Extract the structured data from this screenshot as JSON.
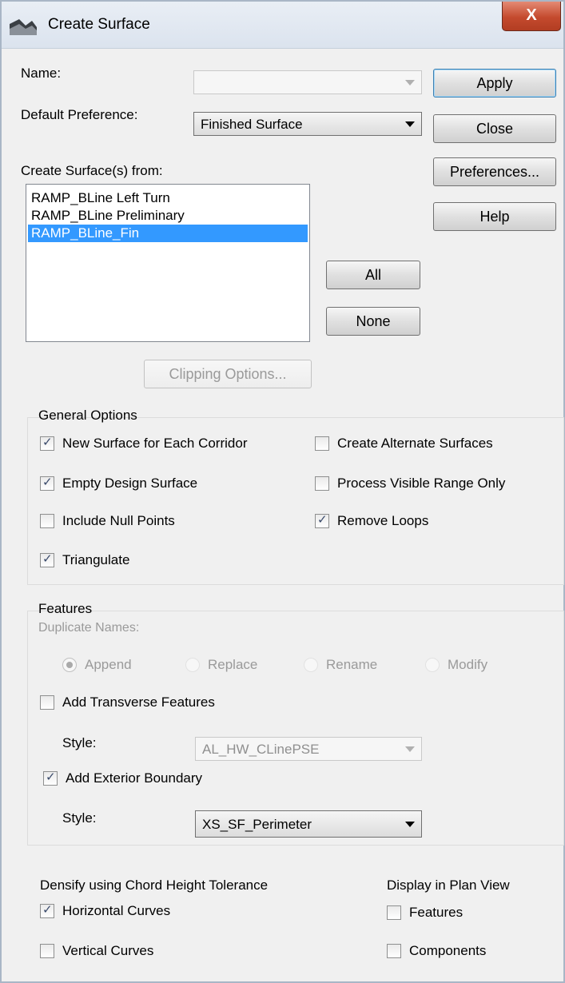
{
  "window": {
    "title": "Create Surface",
    "close_glyph": "X"
  },
  "form": {
    "name_label": "Name:",
    "name_value": "",
    "default_preference_label": "Default Preference:",
    "default_preference_value": "Finished Surface",
    "create_from_label": "Create Surface(s) from:",
    "surfaces": [
      {
        "label": "RAMP_BLine Left Turn",
        "selected": false
      },
      {
        "label": "RAMP_BLine Preliminary",
        "selected": false
      },
      {
        "label": "RAMP_BLine_Fin",
        "selected": true
      }
    ]
  },
  "buttons": {
    "apply": "Apply",
    "close": "Close",
    "preferences": "Preferences...",
    "help": "Help",
    "all": "All",
    "none": "None",
    "clipping": "Clipping Options..."
  },
  "general_options": {
    "title": "General Options",
    "new_surface_each_corridor": {
      "label": "New Surface for Each Corridor",
      "checked": true
    },
    "create_alternate_surfaces": {
      "label": "Create Alternate Surfaces",
      "checked": false
    },
    "empty_design_surface": {
      "label": "Empty Design Surface",
      "checked": true
    },
    "process_visible_range_only": {
      "label": "Process Visible Range Only",
      "checked": false
    },
    "include_null_points": {
      "label": "Include Null Points",
      "checked": false
    },
    "remove_loops": {
      "label": "Remove Loops",
      "checked": true
    },
    "triangulate": {
      "label": "Triangulate",
      "checked": true
    }
  },
  "features": {
    "title": "Features",
    "duplicate_names_label": "Duplicate Names:",
    "duplicate_options": [
      {
        "label": "Append",
        "selected": true
      },
      {
        "label": "Replace",
        "selected": false
      },
      {
        "label": "Rename",
        "selected": false
      },
      {
        "label": "Modify",
        "selected": false
      }
    ],
    "add_transverse": {
      "label": "Add Transverse Features",
      "checked": false
    },
    "transverse_style_label": "Style:",
    "transverse_style_value": "AL_HW_CLinePSE",
    "add_exterior_boundary": {
      "label": "Add Exterior Boundary",
      "checked": true
    },
    "boundary_style_label": "Style:",
    "boundary_style_value": "XS_SF_Perimeter"
  },
  "densify": {
    "title": "Densify using Chord Height Tolerance",
    "horizontal_curves": {
      "label": "Horizontal Curves",
      "checked": true
    },
    "vertical_curves": {
      "label": "Vertical Curves",
      "checked": false
    }
  },
  "plan_view": {
    "title": "Display in Plan View",
    "features": {
      "label": "Features",
      "checked": false
    },
    "components": {
      "label": "Components",
      "checked": false
    }
  },
  "check_glyph": "✓"
}
